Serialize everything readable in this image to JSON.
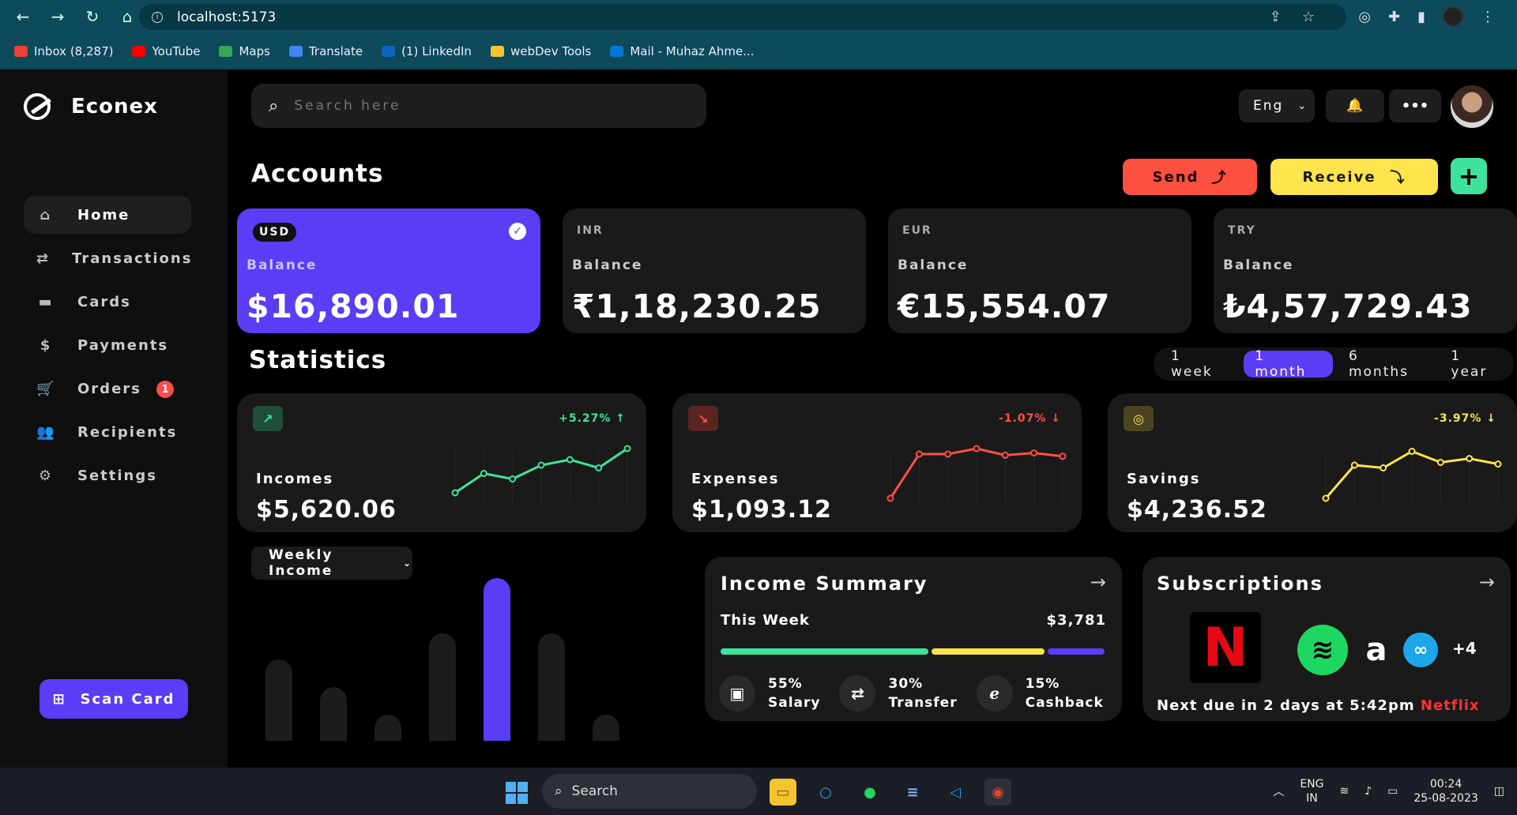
{
  "browser": {
    "url": "localhost:5173",
    "bookmarks": [
      {
        "label": "Inbox (8,287)",
        "color": "#e94235"
      },
      {
        "label": "YouTube",
        "color": "#ff0000"
      },
      {
        "label": "Maps",
        "color": "#34a853"
      },
      {
        "label": "Translate",
        "color": "#4285f4"
      },
      {
        "label": "(1) LinkedIn",
        "color": "#0a66c2"
      },
      {
        "label": "webDev Tools",
        "color": "#f4c430"
      },
      {
        "label": "Mail - Muhaz Ahme...",
        "color": "#0078d4"
      }
    ]
  },
  "sidebar": {
    "brand": "Econex",
    "items": [
      {
        "label": "Home",
        "icon": "home-icon",
        "glyph": "⌂",
        "active": true
      },
      {
        "label": "Transactions",
        "icon": "arrows-icon",
        "glyph": "⇄"
      },
      {
        "label": "Cards",
        "icon": "card-icon",
        "glyph": "▬"
      },
      {
        "label": "Payments",
        "icon": "dollar-icon",
        "glyph": "$"
      },
      {
        "label": "Orders",
        "icon": "cart-icon",
        "glyph": "🛒",
        "badge": "1"
      },
      {
        "label": "Recipients",
        "icon": "users-icon",
        "glyph": "👥"
      },
      {
        "label": "Settings",
        "icon": "gears-icon",
        "glyph": "⚙"
      }
    ],
    "scan_label": "Scan Card"
  },
  "header": {
    "search_placeholder": "Search here",
    "lang": "Eng"
  },
  "accounts": {
    "title": "Accounts",
    "send_label": "Send",
    "receive_label": "Receive",
    "cards": [
      {
        "currency": "USD",
        "label": "Balance",
        "amount": "$16,890.01",
        "selected": true
      },
      {
        "currency": "INR",
        "label": "Balance",
        "amount": "₹1,18,230.25"
      },
      {
        "currency": "EUR",
        "label": "Balance",
        "amount": "€15,554.07"
      },
      {
        "currency": "TRY",
        "label": "Balance",
        "amount": "₺4,57,729.43"
      }
    ]
  },
  "statistics": {
    "title": "Statistics",
    "periods": [
      "1 week",
      "1 month",
      "6 months",
      "1 year"
    ],
    "active_period": "1 month",
    "cards": [
      {
        "label": "Incomes",
        "value": "$5,620.06",
        "change": "+5.27% ↑",
        "color": "#3ee39a",
        "icon_bg": "#1f4d3a",
        "icon": "trending-up-icon",
        "spark": [
          0.2,
          0.55,
          0.45,
          0.7,
          0.8,
          0.65,
          1.0
        ]
      },
      {
        "label": "Expenses",
        "value": "$1,093.12",
        "change": "-1.07% ↓",
        "color": "#ff5040",
        "icon_bg": "#5a2420",
        "icon": "trending-down-icon",
        "spark": [
          0.1,
          0.9,
          0.9,
          1.0,
          0.88,
          0.92,
          0.86
        ]
      },
      {
        "label": "Savings",
        "value": "$4,236.52",
        "change": "-3.97% ↓",
        "color": "#ffe44d",
        "icon_bg": "#4a4420",
        "icon": "coins-icon",
        "spark": [
          0.1,
          0.7,
          0.65,
          0.95,
          0.75,
          0.82,
          0.72
        ]
      }
    ]
  },
  "weekly": {
    "selector": "Weekly Income",
    "bars": [
      0.5,
      0.33,
      0.16,
      0.66,
      1.0,
      0.66,
      0.16
    ],
    "highlight_index": 4
  },
  "income_summary": {
    "title": "Income Summary",
    "period": "This Week",
    "total": "$3,781",
    "segments": [
      {
        "pct": "55%",
        "label": "Salary",
        "color": "#3ee39a",
        "icon": "money-icon",
        "glyph": "▣"
      },
      {
        "pct": "30%",
        "label": "Transfer",
        "color": "#ffe44d",
        "icon": "transfer-icon",
        "glyph": "⇄"
      },
      {
        "pct": "15%",
        "label": "Cashback",
        "color": "#5b3df5",
        "icon": "econex-icon",
        "glyph": "ℯ"
      }
    ],
    "segment_shares": [
      0.55,
      0.3,
      0.15
    ]
  },
  "subscriptions": {
    "title": "Subscriptions",
    "more": "+4",
    "next_due": "Next due in 2 days at 5:42pm",
    "next_service": "Netflix",
    "logos": [
      "netflix-logo",
      "spotify-logo",
      "amazon-logo",
      "cloud-logo"
    ]
  },
  "taskbar": {
    "search": "Search",
    "lang1": "ENG",
    "lang2": "IN",
    "time": "00:24",
    "date": "25-08-2023"
  }
}
